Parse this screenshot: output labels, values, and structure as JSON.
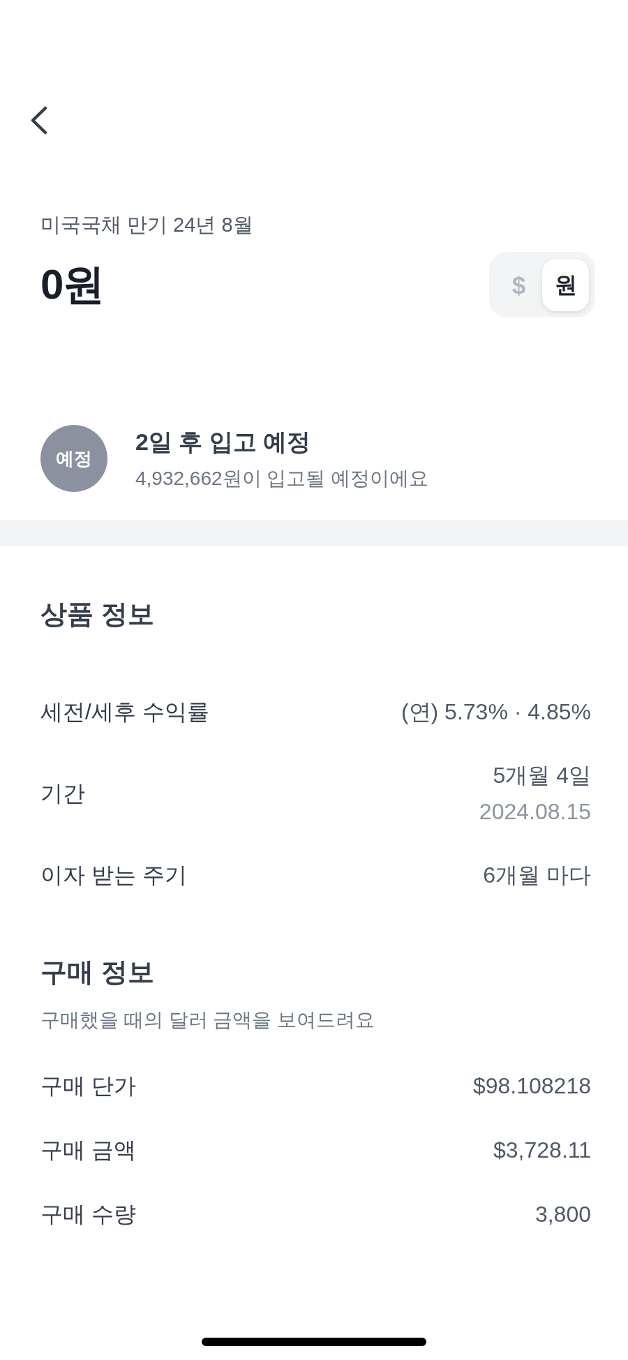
{
  "header": {
    "subtitle": "미국국채 만기 24년 8월",
    "amount": "0원",
    "currency_toggle": [
      {
        "label": "$",
        "selected": false
      },
      {
        "label": "원",
        "selected": true
      }
    ]
  },
  "status": {
    "badge": "예정",
    "title": "2일 후 입고 예정",
    "description": "4,932,662원이 입고될 예정이에요"
  },
  "product_info": {
    "title": "상품 정보",
    "rows": [
      {
        "label": "세전/세후 수익률",
        "value": "(연) 5.73% · 4.85%"
      },
      {
        "label": "기간",
        "value": "5개월 4일",
        "sub_value": "2024.08.15"
      },
      {
        "label": "이자 받는 주기",
        "value": "6개월 마다"
      }
    ]
  },
  "purchase_info": {
    "title": "구매 정보",
    "description": "구매했을 때의 달러 금액을 보여드려요",
    "rows": [
      {
        "label": "구매 단가",
        "value": "$98.108218"
      },
      {
        "label": "구매 금액",
        "value": "$3,728.11"
      },
      {
        "label": "구매 수량",
        "value": "3,800"
      }
    ]
  }
}
